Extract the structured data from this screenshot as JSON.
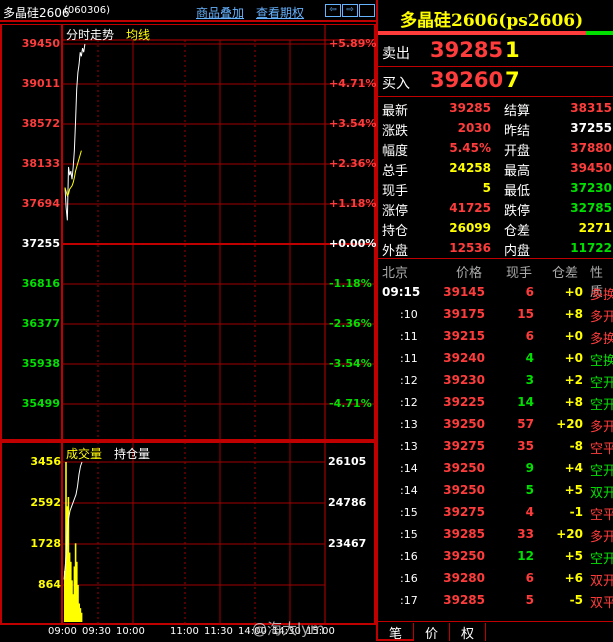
{
  "header": {
    "title": "多晶硅2606",
    "code": "(060306)",
    "overlay_link": "商品叠加",
    "options_link": "查看期权"
  },
  "chart_tabs": {
    "trend": "分时走势",
    "avg": "均线"
  },
  "price_axis": {
    "left": [
      "39450",
      "39011",
      "38572",
      "38133",
      "37694",
      "37255",
      "36816",
      "36377",
      "35938",
      "35499"
    ],
    "right": [
      "+5.89%",
      "+4.71%",
      "+3.54%",
      "+2.36%",
      "+1.18%",
      "+0.00%",
      "-1.18%",
      "-2.36%",
      "-3.54%",
      "-4.71%"
    ]
  },
  "volume_panel": {
    "vol_label": "成交量",
    "oi_label": "持仓量",
    "left": [
      "3456",
      "2592",
      "1728",
      "864"
    ],
    "right": [
      "26105",
      "24786",
      "23467"
    ]
  },
  "time_axis": [
    "09:00",
    "09:30",
    "10:00",
    "11:00",
    "11:30",
    "14:00",
    "14:30",
    "15:00"
  ],
  "watermark": "@海大lym",
  "chart_data": {
    "type": "line",
    "pre_settle": 37255,
    "ylim": [
      35060,
      39450
    ],
    "price": [
      37700,
      37450,
      37300,
      37950,
      37850,
      37900,
      37800,
      37950,
      38150,
      38500,
      38900,
      39100,
      39200,
      39350,
      39300,
      39400,
      39350,
      39450
    ],
    "avg": [
      37700,
      37650,
      37600,
      37620,
      37680,
      37700,
      37720,
      37760,
      37820,
      37900,
      37950,
      38000,
      38050,
      38100,
      38150
    ],
    "volume": [
      1100,
      3456,
      2500,
      2700,
      1500,
      1300,
      900,
      600,
      1200,
      1700,
      1300,
      800,
      400,
      300,
      200
    ],
    "volume_ylim": [
      0,
      3456
    ],
    "oi": [
      23200,
      23600,
      24200,
      24700,
      24900,
      25000,
      25100,
      25200,
      25300,
      25500,
      25800,
      26000,
      26105
    ],
    "oi_ylim": [
      22150,
      26105
    ]
  },
  "quote": {
    "name": "多晶硅2606(ps2606)",
    "sell_label": "卖出",
    "sell_price": "39285",
    "sell_vol": "1",
    "buy_label": "买入",
    "buy_price": "39260",
    "buy_vol": "7",
    "fields": [
      {
        "l": "最新",
        "v": "39285",
        "c": "red",
        "l2": "结算",
        "v2": "38315",
        "c2": "red"
      },
      {
        "l": "涨跌",
        "v": "2030",
        "c": "red",
        "l2": "昨结",
        "v2": "37255",
        "c2": "wht"
      },
      {
        "l": "幅度",
        "v": "5.45%",
        "c": "red",
        "l2": "开盘",
        "v2": "37880",
        "c2": "red"
      },
      {
        "l": "总手",
        "v": "24258",
        "c": "yel",
        "l2": "最高",
        "v2": "39450",
        "c2": "red"
      },
      {
        "l": "现手",
        "v": "5",
        "c": "yel",
        "l2": "最低",
        "v2": "37230",
        "c2": "grn"
      },
      {
        "l": "涨停",
        "v": "41725",
        "c": "red",
        "l2": "跌停",
        "v2": "32785",
        "c2": "grn"
      },
      {
        "l": "持仓",
        "v": "26099",
        "c": "yel",
        "l2": "仓差",
        "v2": "2271",
        "c2": "yel"
      },
      {
        "l": "外盘",
        "v": "12536",
        "c": "red",
        "l2": "内盘",
        "v2": "11722",
        "c2": "grn"
      }
    ]
  },
  "ticks": {
    "headers": [
      "北京",
      "价格",
      "现手",
      "仓差",
      "性质"
    ],
    "rows": [
      {
        "t": "09:15",
        "p": "39145",
        "v": "6",
        "vc": "red",
        "d": "+0",
        "n": "多换",
        "nc": "red"
      },
      {
        "t": ":10",
        "p": "39175",
        "v": "15",
        "vc": "red",
        "d": "+8",
        "n": "多开",
        "nc": "red"
      },
      {
        "t": ":11",
        "p": "39215",
        "v": "6",
        "vc": "red",
        "d": "+0",
        "n": "多换",
        "nc": "red"
      },
      {
        "t": ":11",
        "p": "39240",
        "v": "4",
        "vc": "grn",
        "d": "+0",
        "n": "空换",
        "nc": "grn"
      },
      {
        "t": ":12",
        "p": "39230",
        "v": "3",
        "vc": "grn",
        "d": "+2",
        "n": "空开",
        "nc": "grn"
      },
      {
        "t": ":12",
        "p": "39225",
        "v": "14",
        "vc": "grn",
        "d": "+8",
        "n": "空开",
        "nc": "grn"
      },
      {
        "t": ":13",
        "p": "39250",
        "v": "57",
        "vc": "red",
        "d": "+20",
        "n": "多开",
        "nc": "red"
      },
      {
        "t": ":13",
        "p": "39275",
        "v": "35",
        "vc": "red",
        "d": "-8",
        "n": "空平",
        "nc": "red"
      },
      {
        "t": ":14",
        "p": "39250",
        "v": "9",
        "vc": "grn",
        "d": "+4",
        "n": "空开",
        "nc": "grn"
      },
      {
        "t": ":14",
        "p": "39250",
        "v": "5",
        "vc": "grn",
        "d": "+5",
        "n": "双开",
        "nc": "grn"
      },
      {
        "t": ":15",
        "p": "39275",
        "v": "4",
        "vc": "red",
        "d": "-1",
        "n": "空平",
        "nc": "red"
      },
      {
        "t": ":15",
        "p": "39285",
        "v": "33",
        "vc": "red",
        "d": "+20",
        "n": "多开",
        "nc": "red"
      },
      {
        "t": ":16",
        "p": "39250",
        "v": "12",
        "vc": "grn",
        "d": "+5",
        "n": "空开",
        "nc": "grn"
      },
      {
        "t": ":16",
        "p": "39280",
        "v": "6",
        "vc": "red",
        "d": "+6",
        "n": "双开",
        "nc": "red"
      },
      {
        "t": ":17",
        "p": "39285",
        "v": "5",
        "vc": "red",
        "d": "-5",
        "n": "双平",
        "nc": "red"
      }
    ]
  },
  "bottom_tabs": [
    "笔",
    "价",
    "权"
  ]
}
